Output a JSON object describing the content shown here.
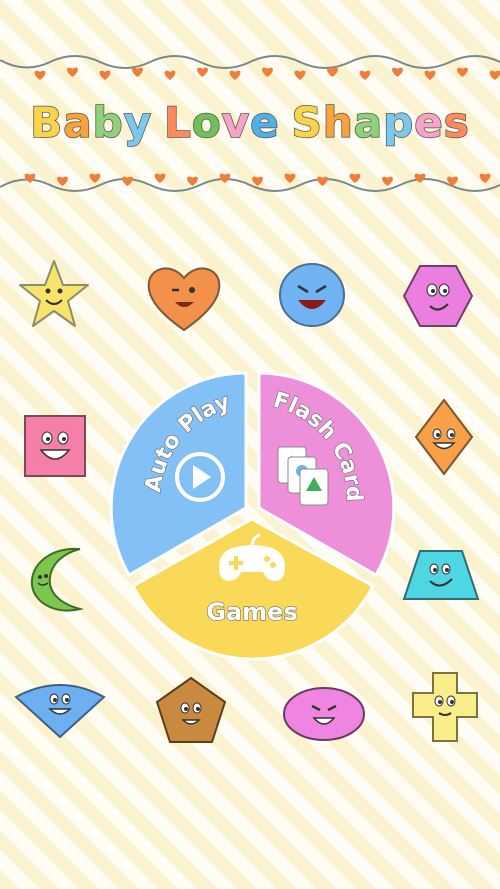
{
  "app": {
    "title": "Baby Love Shapes",
    "title_colors": [
      "#f9d44a",
      "#f7a23c",
      "#8fd07a",
      "#7cc7ee",
      "#ff8a5c",
      "#6ec05a",
      "#f5a3c7",
      "#4fb0e5",
      "#f9d44a",
      "#f7a23c",
      "#8fd07a",
      "#7cc7ee",
      "#f5a3c7",
      "#ff8a5c",
      "#6ec05a",
      "#4fb0e5"
    ]
  },
  "menu": {
    "auto_play": "Auto Play",
    "flash_card": "Flash Card",
    "games": "Games"
  },
  "colors": {
    "auto_play": "#82c0f5",
    "flash_card": "#ee8fd9",
    "games": "#fbd958",
    "heart": "#f07e3a"
  },
  "shapes": [
    {
      "name": "star",
      "color": "#f9e46b"
    },
    {
      "name": "heart",
      "color": "#f39049"
    },
    {
      "name": "circle",
      "color": "#6fb3f2"
    },
    {
      "name": "hexagon",
      "color": "#ea7fdf"
    },
    {
      "name": "square",
      "color": "#f57fa8"
    },
    {
      "name": "diamond",
      "color": "#f7a047"
    },
    {
      "name": "crescent",
      "color": "#7bc74e"
    },
    {
      "name": "trapezoid",
      "color": "#4fd6e3"
    },
    {
      "name": "sector",
      "color": "#6db0f2"
    },
    {
      "name": "pentagon",
      "color": "#c9893f"
    },
    {
      "name": "oval",
      "color": "#ef84e1"
    },
    {
      "name": "cross",
      "color": "#f9ee8a"
    }
  ]
}
